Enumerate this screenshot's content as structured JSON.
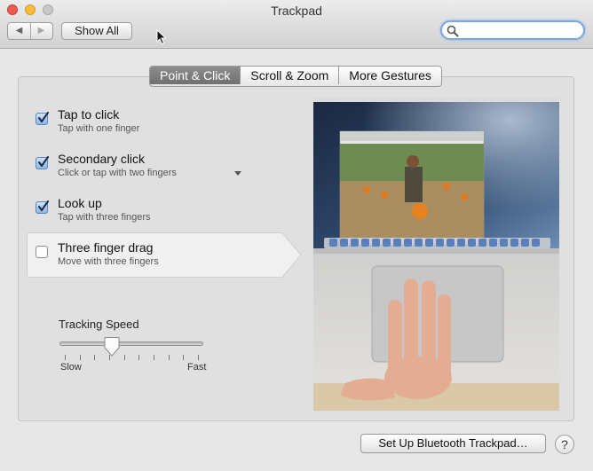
{
  "window": {
    "title": "Trackpad"
  },
  "toolbar": {
    "back_glyph": "◀",
    "forward_glyph": "▶",
    "show_all_label": "Show All",
    "search": {
      "value": "",
      "placeholder": ""
    }
  },
  "tabs": [
    {
      "label": "Point & Click",
      "active": true
    },
    {
      "label": "Scroll & Zoom",
      "active": false
    },
    {
      "label": "More Gestures",
      "active": false
    }
  ],
  "options": [
    {
      "title": "Tap to click",
      "subtitle": "Tap with one finger",
      "checked": true
    },
    {
      "title": "Secondary click",
      "subtitle": "Click or tap with two fingers",
      "checked": true,
      "has_dropdown": true
    },
    {
      "title": "Look up",
      "subtitle": "Tap with three fingers",
      "checked": true
    },
    {
      "title": "Three finger drag",
      "subtitle": "Move with three fingers",
      "checked": false,
      "selected": true
    }
  ],
  "tracking": {
    "label": "Tracking Speed",
    "min_label": "Slow",
    "max_label": "Fast",
    "value_fraction": 0.35,
    "tick_count": 10
  },
  "footer": {
    "bluetooth_label": "Set Up Bluetooth Trackpad…",
    "help_label": "?"
  },
  "colors": {
    "checkbox_blue": "#5b87c2",
    "search_focus": "#79a7e2",
    "tab_active": "#7a7a7a"
  },
  "icons": {
    "search": "search-icon",
    "cursor": "mouse-pointer-icon",
    "help": "question-mark"
  }
}
